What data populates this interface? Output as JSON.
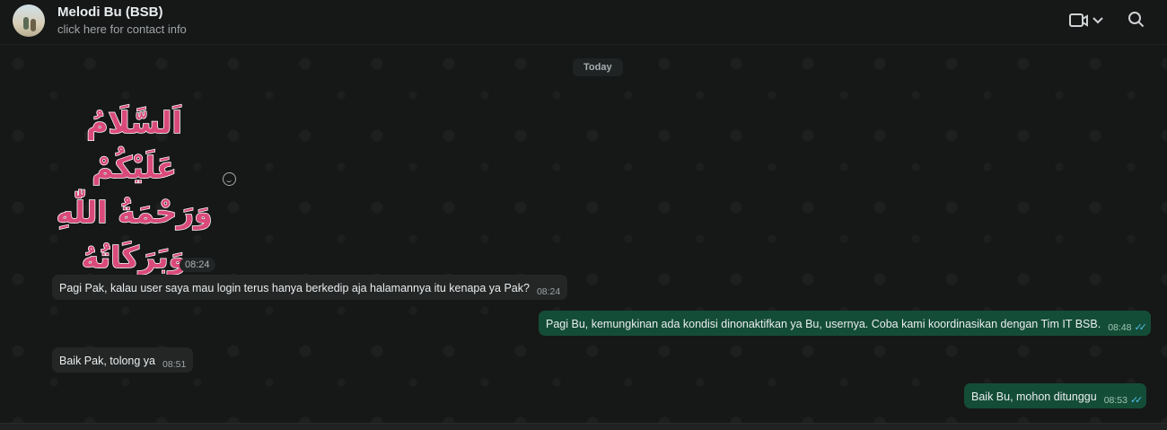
{
  "header": {
    "contact_name": "Melodi Bu (BSB)",
    "subtitle": "click here for contact info"
  },
  "date_divider": "Today",
  "sticker": {
    "text_lines": [
      "اَلسَّلَامُ عَلَيْكُمْ",
      "وَرَحْمَةُ اللّٰهِ",
      "وَبَرَكَاتُهُ"
    ],
    "time": "08:24"
  },
  "messages": [
    {
      "direction": "in",
      "text": "Pagi Pak, kalau user saya mau login terus hanya berkedip aja halamannya itu kenapa ya Pak?",
      "time": "08:24"
    },
    {
      "direction": "out",
      "text": "Pagi Bu, kemungkinan ada kondisi dinonaktifkan ya Bu, usernya. Coba kami koordinasikan dengan Tim IT BSB.",
      "time": "08:48",
      "ticks": "✓✓"
    },
    {
      "direction": "in",
      "text": "Baik Pak, tolong ya",
      "time": "08:51"
    },
    {
      "direction": "out",
      "text": "Baik Bu, mohon ditunggu",
      "time": "08:53",
      "ticks": "✓✓"
    }
  ],
  "colors": {
    "outgoing_bubble": "#144d37",
    "incoming_bubble": "#242626",
    "read_ticks": "#53bdeb"
  }
}
